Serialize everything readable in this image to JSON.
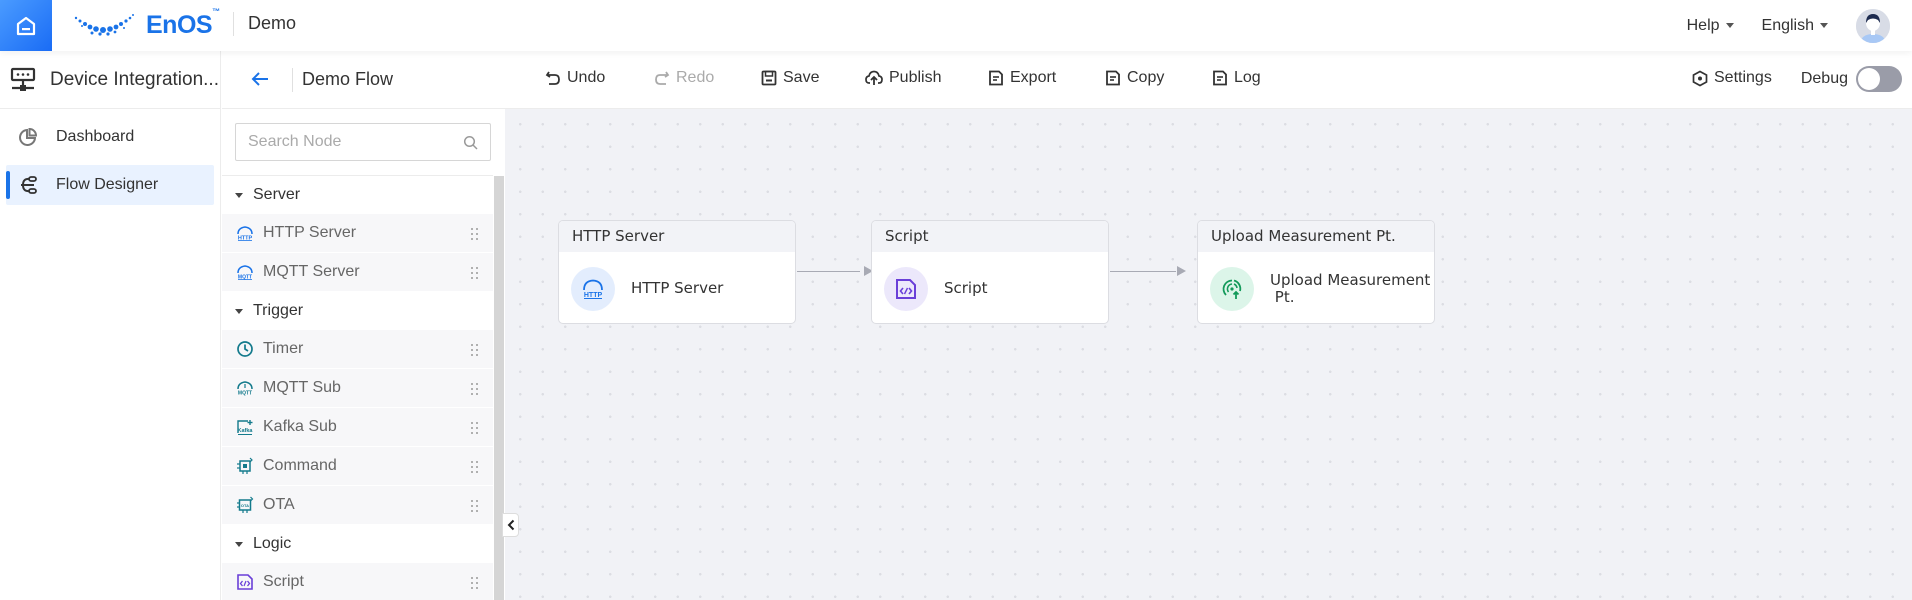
{
  "header": {
    "brand": "EnOS",
    "brand_tm": "™",
    "app_name": "Demo",
    "help_label": "Help",
    "language_label": "English"
  },
  "leftnav": {
    "title": "Device Integration...",
    "items": [
      {
        "label": "Dashboard",
        "icon": "pie-chart-icon",
        "active": false
      },
      {
        "label": "Flow Designer",
        "icon": "flow-icon",
        "active": true
      }
    ]
  },
  "flowbar": {
    "flow_name": "Demo Flow",
    "tools": [
      {
        "label": "Undo",
        "icon": "undo-icon",
        "disabled": false
      },
      {
        "label": "Redo",
        "icon": "redo-icon",
        "disabled": true
      },
      {
        "label": "Save",
        "icon": "save-icon",
        "disabled": false
      },
      {
        "label": "Publish",
        "icon": "cloud-upload-icon",
        "disabled": false
      },
      {
        "label": "Export",
        "icon": "document-icon",
        "disabled": false
      },
      {
        "label": "Copy",
        "icon": "document-icon",
        "disabled": false
      },
      {
        "label": "Log",
        "icon": "document-icon",
        "disabled": false
      }
    ],
    "settings_label": "Settings",
    "debug_label": "Debug",
    "debug_on": false
  },
  "palette": {
    "search_placeholder": "Search Node",
    "search_value": "",
    "categories": [
      {
        "name": "Server",
        "items": [
          "HTTP Server",
          "MQTT Server"
        ]
      },
      {
        "name": "Trigger",
        "items": [
          "Timer",
          "MQTT Sub",
          "Kafka Sub",
          "Command",
          "OTA"
        ]
      },
      {
        "name": "Logic",
        "items": [
          "Script"
        ]
      }
    ]
  },
  "canvas": {
    "nodes": [
      {
        "header": "HTTP Server",
        "label": "HTTP Server",
        "icon": "http-cloud-icon",
        "color": "#1a73e8",
        "bg": "#e3edfd"
      },
      {
        "header": "Script",
        "label": "Script",
        "icon": "script-icon",
        "color": "#6a3fd8",
        "bg": "#ece8fb"
      },
      {
        "header": "Upload Measurement Pt.",
        "label_line1": "Upload Measurement",
        "label_line2": " Pt.",
        "icon": "upload-measurement-icon",
        "color": "#139a5a",
        "bg": "#dcf5e9"
      }
    ],
    "edges": [
      {
        "from": "HTTP Server",
        "to": "Script"
      },
      {
        "from": "Script",
        "to": "Upload Measurement Pt."
      }
    ]
  },
  "colors": {
    "accent": "#1a73e8",
    "canvas_bg": "#f1f2f6",
    "nav_active_bg": "#e9f2ff"
  }
}
